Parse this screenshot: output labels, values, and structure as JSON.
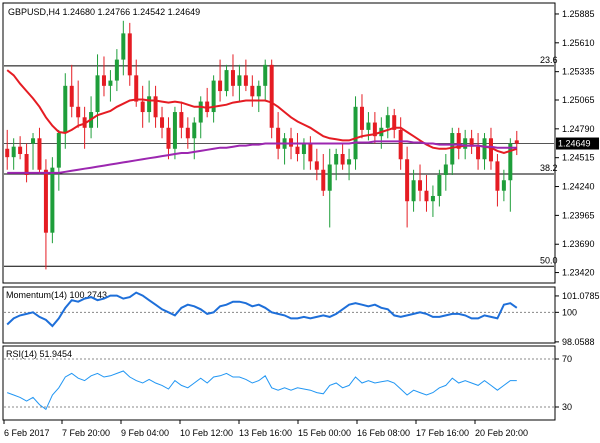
{
  "chart_data": {
    "type": "candlestick",
    "symbol_header": "GBPUSD,H4  1.24680 1.24766 1.24542 1.24649",
    "current_price": "1.24649",
    "price_axis": {
      "ylim": [
        1.2333,
        1.2598
      ],
      "ticks": [
        "1.25885",
        "1.25610",
        "1.25335",
        "1.25065",
        "1.24790",
        "1.24515",
        "1.24240",
        "1.23965",
        "1.23690",
        "1.23420"
      ]
    },
    "fib_levels": [
      {
        "label": "23.6",
        "price": 1.2539
      },
      {
        "label": "38.2",
        "price": 1.2436
      },
      {
        "label": "50.0",
        "price": 1.2348
      }
    ],
    "current_line_price": 1.2465,
    "x_labels": [
      "6 Feb 2017",
      "7 Feb 20:00",
      "9 Feb 04:00",
      "10 Feb 12:00",
      "13 Feb 16:00",
      "15 Feb 00:00",
      "16 Feb 08:00",
      "17 Feb 16:00",
      "20 Feb 20:00"
    ],
    "candles": [
      [
        1.246,
        1.2478,
        1.244,
        1.2452
      ],
      [
        1.2452,
        1.247,
        1.244,
        1.2462
      ],
      [
        1.2462,
        1.2472,
        1.245,
        1.2455
      ],
      [
        1.2455,
        1.2465,
        1.2428,
        1.2435
      ],
      [
        1.2465,
        1.2475,
        1.244,
        1.247
      ],
      [
        1.247,
        1.248,
        1.2436,
        1.244
      ],
      [
        1.244,
        1.245,
        1.2345,
        1.238
      ],
      [
        1.238,
        1.2452,
        1.237,
        1.2442
      ],
      [
        1.2442,
        1.2478,
        1.242,
        1.2475
      ],
      [
        1.2475,
        1.2532,
        1.246,
        1.252
      ],
      [
        1.252,
        1.254,
        1.249,
        1.25
      ],
      [
        1.25,
        1.2525,
        1.248,
        1.249
      ],
      [
        1.249,
        1.25,
        1.246,
        1.248
      ],
      [
        1.248,
        1.251,
        1.247,
        1.2495
      ],
      [
        1.2495,
        1.255,
        1.248,
        1.253
      ],
      [
        1.253,
        1.2548,
        1.251,
        1.252
      ],
      [
        1.252,
        1.2535,
        1.2505,
        1.2525
      ],
      [
        1.2525,
        1.2555,
        1.2515,
        1.2545
      ],
      [
        1.2545,
        1.2582,
        1.253,
        1.257
      ],
      [
        1.257,
        1.258,
        1.252,
        1.253
      ],
      [
        1.253,
        1.2545,
        1.25,
        1.2505
      ],
      [
        1.2505,
        1.252,
        1.248,
        1.2495
      ],
      [
        1.2495,
        1.2525,
        1.2485,
        1.251
      ],
      [
        1.251,
        1.252,
        1.248,
        1.249
      ],
      [
        1.249,
        1.25,
        1.247,
        1.248
      ],
      [
        1.248,
        1.249,
        1.245,
        1.246
      ],
      [
        1.246,
        1.25,
        1.245,
        1.2495
      ],
      [
        1.2495,
        1.2505,
        1.247,
        1.248
      ],
      [
        1.248,
        1.249,
        1.246,
        1.247
      ],
      [
        1.247,
        1.249,
        1.245,
        1.2485
      ],
      [
        1.2485,
        1.251,
        1.247,
        1.2505
      ],
      [
        1.2505,
        1.2518,
        1.249,
        1.2495
      ],
      [
        1.2495,
        1.253,
        1.2485,
        1.2525
      ],
      [
        1.2525,
        1.2545,
        1.2505,
        1.2515
      ],
      [
        1.2515,
        1.254,
        1.251,
        1.2535
      ],
      [
        1.2535,
        1.255,
        1.251,
        1.252
      ],
      [
        1.252,
        1.254,
        1.2505,
        1.253
      ],
      [
        1.253,
        1.2545,
        1.2515,
        1.252
      ],
      [
        1.252,
        1.253,
        1.25,
        1.251
      ],
      [
        1.251,
        1.2525,
        1.2495,
        1.252
      ],
      [
        1.252,
        1.2545,
        1.2505,
        1.254
      ],
      [
        1.254,
        1.2545,
        1.247,
        1.248
      ],
      [
        1.248,
        1.2495,
        1.245,
        1.246
      ],
      [
        1.246,
        1.2475,
        1.2445,
        1.247
      ],
      [
        1.247,
        1.248,
        1.245,
        1.2462
      ],
      [
        1.2462,
        1.2475,
        1.2448,
        1.2455
      ],
      [
        1.2455,
        1.247,
        1.244,
        1.2465
      ],
      [
        1.2465,
        1.2472,
        1.244,
        1.2448
      ],
      [
        1.2448,
        1.246,
        1.243,
        1.244
      ],
      [
        1.244,
        1.2455,
        1.2415,
        1.242
      ],
      [
        1.242,
        1.246,
        1.2385,
        1.2445
      ],
      [
        1.2445,
        1.246,
        1.243,
        1.2455
      ],
      [
        1.2455,
        1.2465,
        1.244,
        1.2445
      ],
      [
        1.2445,
        1.246,
        1.243,
        1.245
      ],
      [
        1.245,
        1.251,
        1.244,
        1.25
      ],
      [
        1.25,
        1.2512,
        1.247,
        1.2478
      ],
      [
        1.2478,
        1.2495,
        1.2468,
        1.2485
      ],
      [
        1.2485,
        1.2495,
        1.2465,
        1.2472
      ],
      [
        1.2472,
        1.249,
        1.246,
        1.248
      ],
      [
        1.248,
        1.25,
        1.247,
        1.2492
      ],
      [
        1.2492,
        1.2498,
        1.247,
        1.2478
      ],
      [
        1.2478,
        1.249,
        1.244,
        1.245
      ],
      [
        1.245,
        1.2462,
        1.2385,
        1.241
      ],
      [
        1.241,
        1.244,
        1.24,
        1.243
      ],
      [
        1.243,
        1.2445,
        1.241,
        1.242
      ],
      [
        1.242,
        1.2435,
        1.24,
        1.241
      ],
      [
        1.241,
        1.2425,
        1.2395,
        1.2415
      ],
      [
        1.2415,
        1.244,
        1.2405,
        1.2435
      ],
      [
        1.2435,
        1.2455,
        1.242,
        1.2445
      ],
      [
        1.2445,
        1.248,
        1.2435,
        1.2475
      ],
      [
        1.2475,
        1.248,
        1.245,
        1.246
      ],
      [
        1.246,
        1.2478,
        1.245,
        1.247
      ],
      [
        1.247,
        1.2478,
        1.2455,
        1.2462
      ],
      [
        1.2462,
        1.2475,
        1.244,
        1.245
      ],
      [
        1.245,
        1.2475,
        1.244,
        1.247
      ],
      [
        1.247,
        1.248,
        1.244,
        1.2448
      ],
      [
        1.2448,
        1.2455,
        1.2405,
        1.242
      ],
      [
        1.242,
        1.244,
        1.241,
        1.243
      ],
      [
        1.243,
        1.247,
        1.24,
        1.2465
      ],
      [
        1.2468,
        1.2477,
        1.2454,
        1.2465
      ]
    ],
    "ma_red": [
      1.2535,
      1.253,
      1.2522,
      1.2515,
      1.2508,
      1.25,
      1.249,
      1.2482,
      1.2476,
      1.2475,
      1.2478,
      1.2482,
      1.2484,
      1.2488,
      1.2492,
      1.2494,
      1.2496,
      1.25,
      1.2503,
      1.2506,
      1.2507,
      1.2507,
      1.2506,
      1.2506,
      1.2505,
      1.2504,
      1.2505,
      1.2504,
      1.2502,
      1.25,
      1.25,
      1.2499,
      1.25,
      1.2501,
      1.2502,
      1.2504,
      1.2505,
      1.2506,
      1.2506,
      1.2506,
      1.2506,
      1.2504,
      1.25,
      1.2495,
      1.249,
      1.2486,
      1.2483,
      1.248,
      1.2476,
      1.2472,
      1.247,
      1.2469,
      1.2468,
      1.2468,
      1.247,
      1.2472,
      1.2473,
      1.2474,
      1.2476,
      1.2478,
      1.248,
      1.248,
      1.2476,
      1.2472,
      1.2468,
      1.2464,
      1.2461,
      1.246,
      1.246,
      1.2461,
      1.2462,
      1.2463,
      1.2463,
      1.2463,
      1.2462,
      1.2461,
      1.2458,
      1.2456,
      1.2458,
      1.246
    ],
    "ma_purple": [
      1.2437,
      1.2437,
      1.2437,
      1.2437,
      1.2437,
      1.2437,
      1.2437,
      1.2437,
      1.2437,
      1.2438,
      1.2439,
      1.244,
      1.2441,
      1.2442,
      1.2443,
      1.2444,
      1.2445,
      1.2446,
      1.2447,
      1.2448,
      1.2449,
      1.245,
      1.2451,
      1.2452,
      1.2453,
      1.2454,
      1.2455,
      1.2456,
      1.2456,
      1.2457,
      1.2458,
      1.2459,
      1.246,
      1.2461,
      1.2461,
      1.2462,
      1.2463,
      1.2463,
      1.2464,
      1.2464,
      1.2465,
      1.2465,
      1.2465,
      1.2465,
      1.2465,
      1.2465,
      1.2465,
      1.2465,
      1.2465,
      1.2465,
      1.2465,
      1.2465,
      1.2465,
      1.2465,
      1.2466,
      1.2466,
      1.2466,
      1.2467,
      1.2467,
      1.2467,
      1.2467,
      1.2467,
      1.2467,
      1.2466,
      1.2466,
      1.2465,
      1.2465,
      1.2464,
      1.2464,
      1.2464,
      1.2464,
      1.2463,
      1.2463,
      1.2463,
      1.2462,
      1.2462,
      1.2461,
      1.2461,
      1.2461,
      1.2461
    ],
    "momentum": {
      "label": "Momentum(14) 100.2743",
      "ylim": [
        98.05,
        101.6
      ],
      "ticks": [
        "101.0785",
        "100",
        "98.0588"
      ],
      "reference": 100,
      "values": [
        99.2,
        99.6,
        99.8,
        99.9,
        100.0,
        99.7,
        99.5,
        99.1,
        99.6,
        100.3,
        100.8,
        100.7,
        100.9,
        101.0,
        100.8,
        100.9,
        101.1,
        101.1,
        100.9,
        101.0,
        101.3,
        101.1,
        100.8,
        100.5,
        100.2,
        100.0,
        99.8,
        100.3,
        100.5,
        100.4,
        100.2,
        99.9,
        100.0,
        100.4,
        100.5,
        100.7,
        100.7,
        100.6,
        100.4,
        100.5,
        100.3,
        100.0,
        99.9,
        99.8,
        99.6,
        99.6,
        99.7,
        99.6,
        99.7,
        99.8,
        99.7,
        99.9,
        100.2,
        100.5,
        100.6,
        100.5,
        100.4,
        100.5,
        100.3,
        100.2,
        99.8,
        99.7,
        99.8,
        99.9,
        100.0,
        99.9,
        99.7,
        99.7,
        99.8,
        99.9,
        99.9,
        99.8,
        99.6,
        99.6,
        99.8,
        99.7,
        99.6,
        100.5,
        100.6,
        100.3
      ]
    },
    "rsi": {
      "label": "RSI(14) 51.9454",
      "ylim": [
        20,
        80
      ],
      "ticks": [
        "70",
        "30"
      ],
      "levels": [
        70,
        30
      ],
      "values": [
        42,
        40,
        38,
        35,
        38,
        32,
        28,
        40,
        46,
        55,
        58,
        54,
        52,
        56,
        58,
        55,
        56,
        58,
        60,
        55,
        52,
        50,
        53,
        50,
        48,
        45,
        52,
        48,
        46,
        50,
        54,
        50,
        55,
        56,
        58,
        55,
        55,
        53,
        50,
        52,
        56,
        46,
        44,
        46,
        44,
        46,
        45,
        44,
        42,
        41,
        48,
        50,
        46,
        48,
        55,
        50,
        52,
        50,
        51,
        52,
        50,
        45,
        40,
        44,
        42,
        40,
        42,
        46,
        48,
        54,
        50,
        52,
        50,
        48,
        52,
        48,
        44,
        48,
        52,
        52
      ]
    }
  }
}
